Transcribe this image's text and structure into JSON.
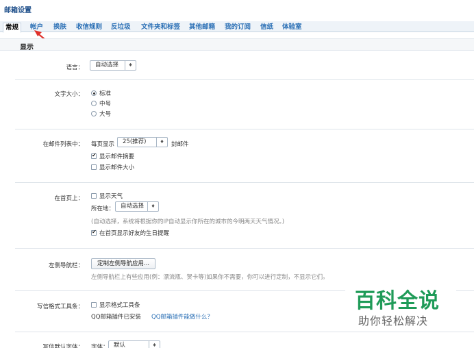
{
  "title": "邮箱设置",
  "tabs": [
    "常规",
    "帐户",
    "换肤",
    "收信规则",
    "反垃圾",
    "文件夹和标签",
    "其他邮箱",
    "我的订阅",
    "信纸",
    "体验室"
  ],
  "section_title": "显示",
  "language": {
    "label": "语言：",
    "selected": "自动选择"
  },
  "font_size": {
    "label": "文字大小：",
    "options": [
      "标准",
      "中号",
      "大号"
    ],
    "selected_index": 0
  },
  "mail_list": {
    "label": "在邮件列表中：",
    "per_page_prefix": "每页显示",
    "per_page_value": "25(推荐)",
    "per_page_suffix": "封邮件",
    "show_summary": "显示邮件摘要",
    "show_size": "显示邮件大小",
    "show_summary_checked": true,
    "show_size_checked": false
  },
  "homepage": {
    "label": "在首页上：",
    "show_weather": "显示天气",
    "show_weather_checked": false,
    "location_label": "所在地：",
    "location_value": "自动选择",
    "hint": "(自动选择，系统将根据你的IP自动显示你所在的城市的今明两天天气情况。)",
    "birthday": "在首页显示好友的生日提醒",
    "birthday_checked": true
  },
  "left_nav": {
    "label": "左侧导航栏：",
    "button": "定制左侧导航应用...",
    "hint": "左侧导航栏上有些应用(例：漂流瓶、贺卡等)如果你不需要，你可以进行定制，不显示它们。"
  },
  "toolbar": {
    "label": "写信格式工具条：",
    "show_toolbar": "显示格式工具条",
    "show_toolbar_checked": false,
    "installed": "QQ邮箱插件已安装",
    "link": "QQ邮箱插件能做什么？"
  },
  "default_font": {
    "label": "写信默认字体：",
    "font_label": "字体：",
    "font_value": "默认"
  },
  "watermark": {
    "main": "百科全说",
    "sub": "助你轻松解决"
  },
  "colors": {
    "link": "#2a6fb5",
    "watermark": "#1f9b58",
    "arrow": "#e0302a"
  }
}
